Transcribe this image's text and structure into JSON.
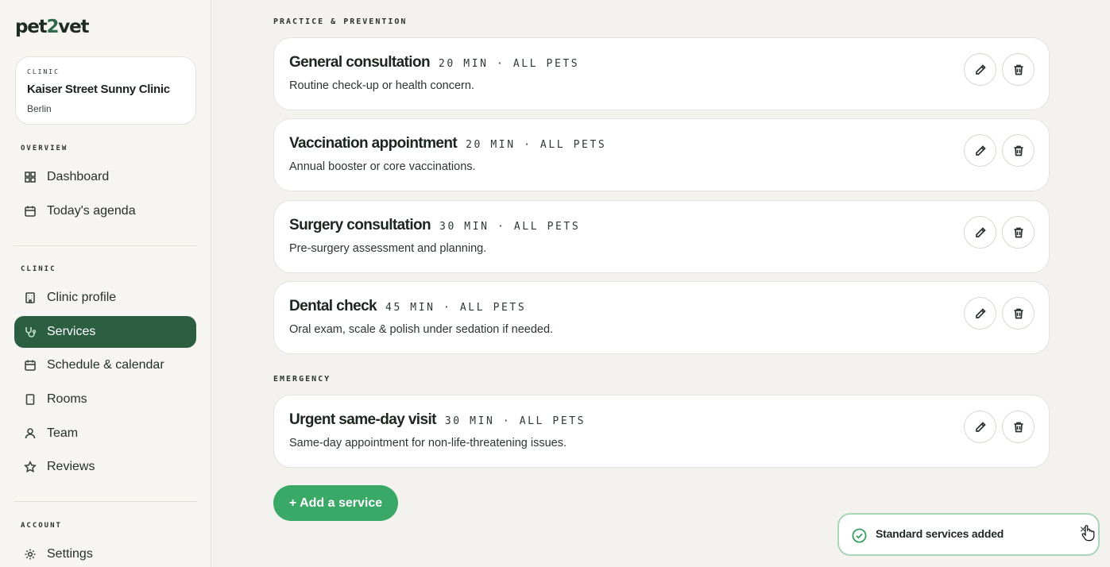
{
  "brand": {
    "logo_pre": "pet",
    "logo_num": "2",
    "logo_post": "vet"
  },
  "clinic_card": {
    "label": "CLINIC",
    "name": "Kaiser Street Sunny Clinic",
    "city": "Berlin"
  },
  "sidebar": {
    "overview_label": "OVERVIEW",
    "clinic_label": "CLINIC",
    "account_label": "ACCOUNT",
    "items": [
      {
        "label": "Dashboard",
        "icon": "grid-icon"
      },
      {
        "label": "Today's agenda",
        "icon": "calendar-icon"
      },
      {
        "label": "Clinic profile",
        "icon": "building-icon"
      },
      {
        "label": "Services",
        "icon": "stethoscope-icon",
        "active": true
      },
      {
        "label": "Schedule & calendar",
        "icon": "calendar-icon"
      },
      {
        "label": "Rooms",
        "icon": "door-icon"
      },
      {
        "label": "Team",
        "icon": "person-icon"
      },
      {
        "label": "Reviews",
        "icon": "star-icon"
      },
      {
        "label": "Settings",
        "icon": "gear-icon"
      }
    ]
  },
  "groups": [
    {
      "label": "PRACTICE & PREVENTION",
      "services": [
        {
          "title": "General consultation",
          "meta": "20 MIN · ALL PETS",
          "desc": "Routine check-up or health concern."
        },
        {
          "title": "Vaccination appointment",
          "meta": "20 MIN · ALL PETS",
          "desc": "Annual booster or core vaccinations."
        },
        {
          "title": "Surgery consultation",
          "meta": "30 MIN · ALL PETS",
          "desc": "Pre-surgery assessment and planning."
        },
        {
          "title": "Dental check",
          "meta": "45 MIN · ALL PETS",
          "desc": "Oral exam, scale & polish under sedation if needed."
        }
      ]
    },
    {
      "label": "EMERGENCY",
      "services": [
        {
          "title": "Urgent same-day visit",
          "meta": "30 MIN · ALL PETS",
          "desc": "Same-day appointment for non-life-threatening issues."
        }
      ]
    }
  ],
  "add_service_label": "+ Add a service",
  "toast": {
    "message": "Standard services added",
    "close": "×"
  },
  "colors": {
    "primary": "#2c5e42",
    "accent": "#3aa867",
    "background": "#f3f2ee"
  }
}
